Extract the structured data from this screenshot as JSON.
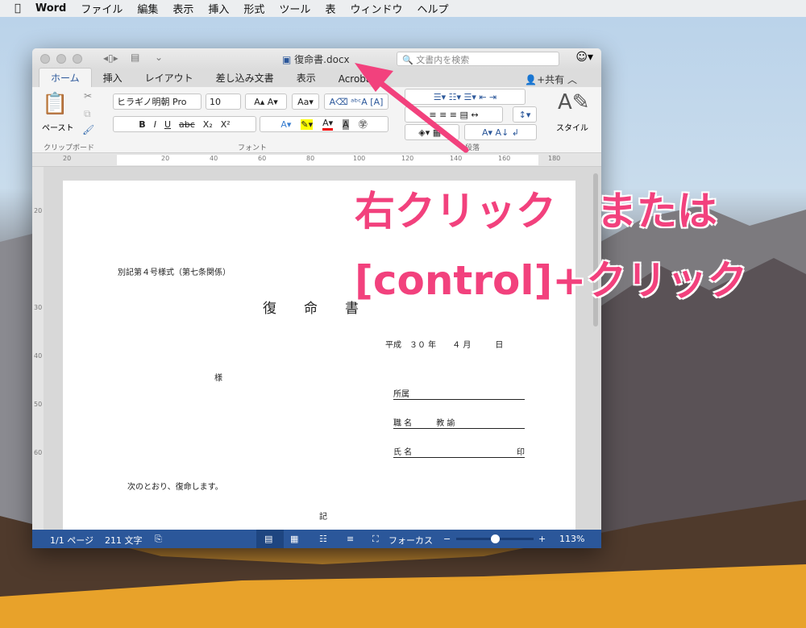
{
  "menubar": {
    "app": "Word",
    "items": [
      "ファイル",
      "編集",
      "表示",
      "挿入",
      "形式",
      "ツール",
      "表",
      "ウィンドウ",
      "ヘルプ"
    ]
  },
  "window": {
    "title": "復命書.docx",
    "search_placeholder": "文書内を検索"
  },
  "tabs": [
    "ホーム",
    "挿入",
    "レイアウト",
    "差し込み文書",
    "表示",
    "Acrobat"
  ],
  "share": "共有",
  "ribbon": {
    "paste": "ペースト",
    "clipboard": "クリップボード",
    "font_name": "ヒラギノ明朝 Pro",
    "font_size": "10",
    "font_group": "フォント",
    "paragraph_group": "段落",
    "styles": "スタイル",
    "bold": "B",
    "italic": "I",
    "underline": "U",
    "strike": "abc",
    "subscript": "X₂",
    "superscript": "X²"
  },
  "ruler": [
    "20",
    "20",
    "40",
    "60",
    "80",
    "100",
    "120",
    "140",
    "160",
    "180"
  ],
  "vruler": [
    "20",
    "30",
    "40",
    "50",
    "60"
  ],
  "document": {
    "form": "別記第４号様式（第七条関係）",
    "title": "復　　命　　書",
    "date": "平成　３０ 年　　４ 月　　　日",
    "addressee": "様",
    "affiliation": "所属",
    "position_label": "職 名",
    "position_value": "教 諭",
    "name_label": "氏 名",
    "seal": "印",
    "body": "次のとおり、復命します。",
    "note": "記"
  },
  "status": {
    "page": "1/1 ページ",
    "words": "211 文字",
    "focus": "フォーカス",
    "zoom": "113%",
    "zoom_slider": 0.5
  },
  "annotation": {
    "line1": "右クリック　または",
    "line2": "[control]+クリック",
    "color": "#f2417d"
  },
  "colors": {
    "accent": "#2b579a"
  }
}
